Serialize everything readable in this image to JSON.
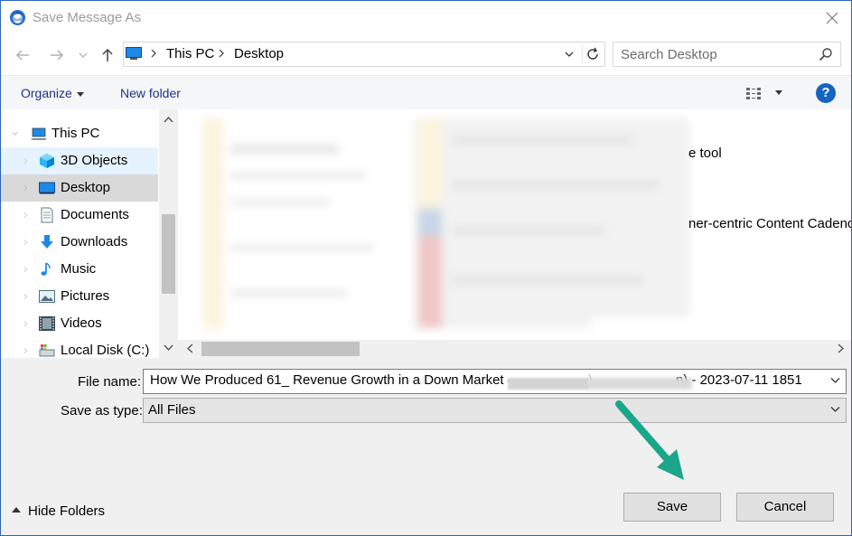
{
  "window": {
    "title": "Save Message As",
    "close_label": "✕"
  },
  "address_bar": {
    "segments": [
      "This PC",
      "Desktop"
    ]
  },
  "search": {
    "placeholder": "Search Desktop"
  },
  "toolbar": {
    "organize_label": "Organize",
    "new_folder_label": "New folder",
    "help_label": "?"
  },
  "nav_pane": {
    "root": "This PC",
    "items": [
      {
        "label": "3D Objects",
        "icon": "3d-objects-icon"
      },
      {
        "label": "Desktop",
        "icon": "desktop-icon"
      },
      {
        "label": "Documents",
        "icon": "documents-icon"
      },
      {
        "label": "Downloads",
        "icon": "downloads-icon"
      },
      {
        "label": "Music",
        "icon": "music-icon"
      },
      {
        "label": "Pictures",
        "icon": "pictures-icon"
      },
      {
        "label": "Videos",
        "icon": "videos-icon"
      },
      {
        "label": "Local Disk (C:)",
        "icon": "local-disk-icon"
      }
    ],
    "selected": "Desktop"
  },
  "file_area": {
    "visible_fragments": [
      "e tool",
      "ner-centric Content Cadence"
    ]
  },
  "form": {
    "file_name_label": "File name:",
    "file_name_prefix": "How We Produced 61_ Revenue Growth in a Down Market - ",
    "file_name_paren_close": ")",
    "file_name_suffix": "n) - 2023-07-11 1851",
    "save_as_type_label": "Save as type:",
    "save_as_type_value": "All Files"
  },
  "buttons": {
    "save": "Save",
    "cancel": "Cancel",
    "hide_folders": "Hide Folders"
  },
  "colors": {
    "accent": "#1565c0",
    "selected_bg": "#cce8ff",
    "annotation_arrow": "#1aa68a"
  }
}
